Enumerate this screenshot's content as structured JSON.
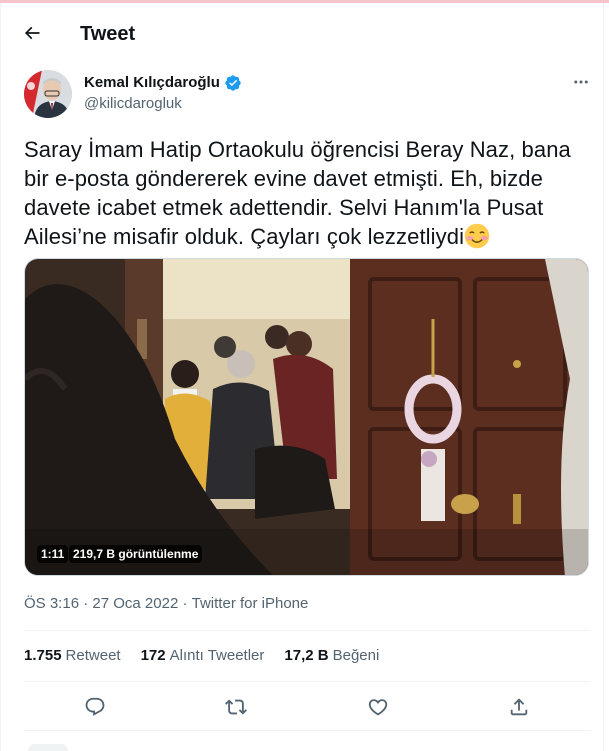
{
  "header": {
    "title": "Tweet"
  },
  "author": {
    "name": "Kemal Kılıçdaroğlu",
    "handle": "@kilicdarogluk",
    "verified": true
  },
  "tweet": {
    "text": "Saray İmam Hatip Ortaokulu öğrencisi Beray Naz, bana bir e-posta göndererek evine davet etmişti. Eh, bizde davete icabet etmek adettendir. Selvi Hanım'la Pusat Ailesi’ne misafir olduk. Çayları çok lezzetliydi",
    "emoji": "smiling-face-with-blush"
  },
  "media": {
    "duration": "1:11",
    "views": "219,7 B görüntülenme"
  },
  "meta": {
    "time": "ÖS 3:16",
    "separator": " · ",
    "date": "27 Oca 2022",
    "source": "Twitter for iPhone"
  },
  "stats": [
    {
      "count": "1.755",
      "label": "Retweet"
    },
    {
      "count": "172",
      "label": "Alıntı Tweetler"
    },
    {
      "count": "17,2 B",
      "label": "Beğeni"
    }
  ],
  "colors": {
    "accent": "#1d9bf0",
    "text": "#0f1419",
    "secondary": "#536471",
    "border": "#eff3f4"
  },
  "icons": {
    "back": "arrow-left-icon",
    "more": "more-horizontal-icon",
    "reply": "reply-icon",
    "retweet": "retweet-icon",
    "like": "heart-icon",
    "share": "share-icon"
  }
}
